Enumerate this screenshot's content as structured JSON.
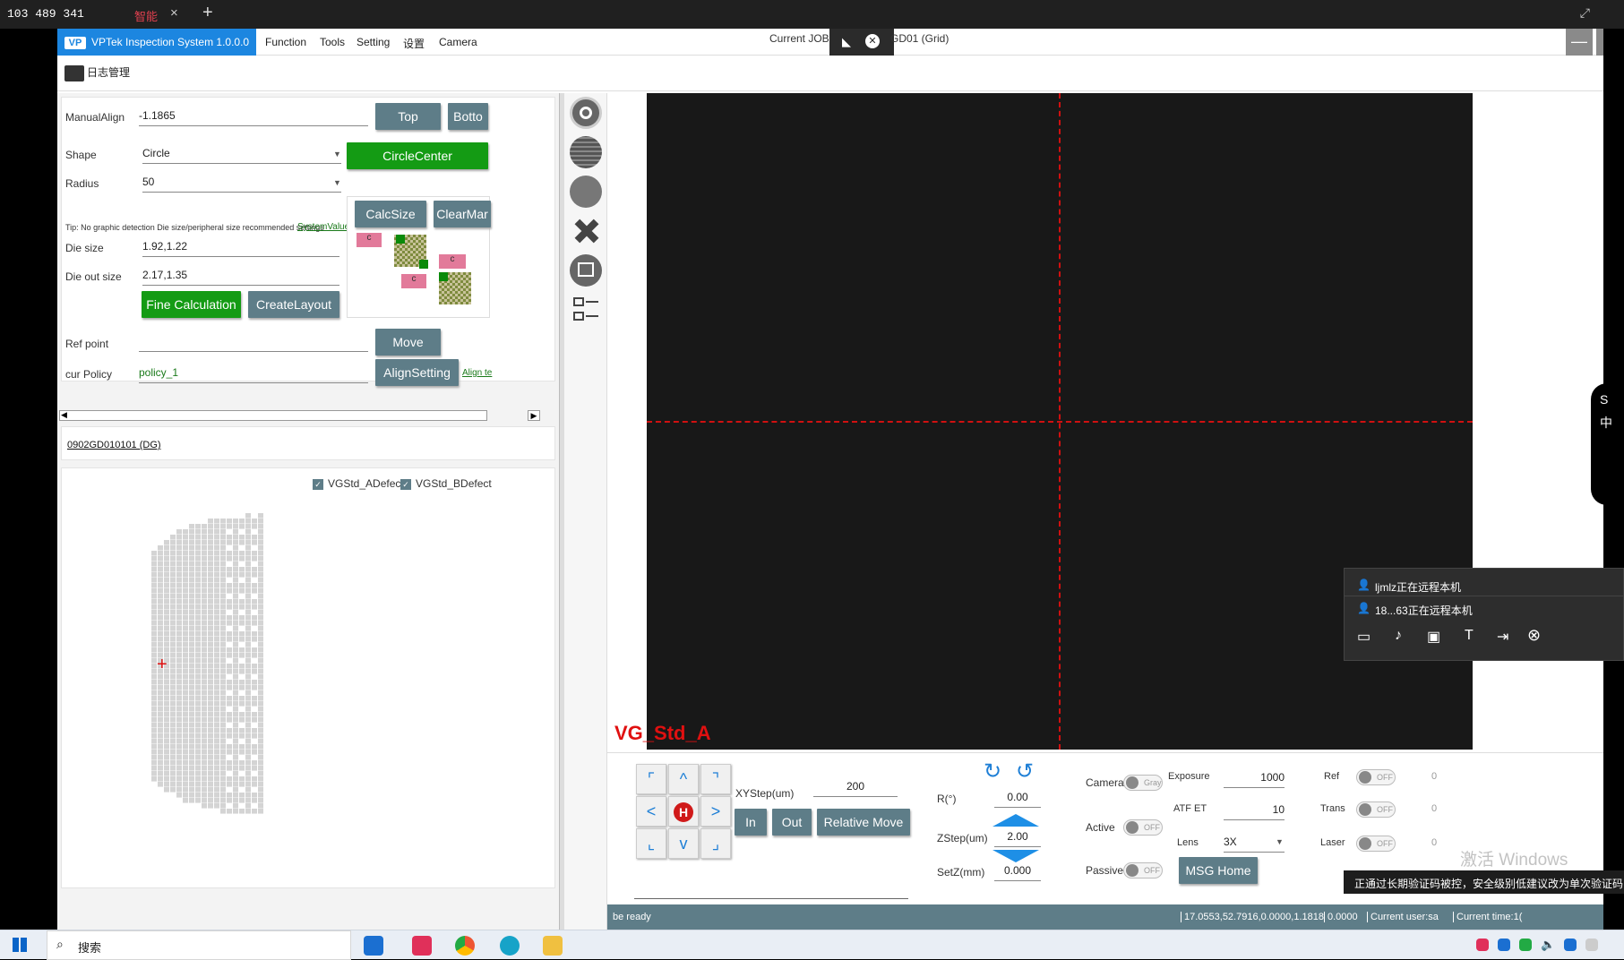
{
  "topbar": {
    "signal_text": "103 489 341",
    "tab_label": "智能",
    "close_glyph": "×",
    "plus_glyph": "+",
    "expand_glyph": "⤢"
  },
  "app": {
    "brand_logo": "VP",
    "brand_title": "VPTek Inspection System 1.0.0.0",
    "menu": [
      "Function",
      "Tools",
      "Setting",
      "设置",
      "Camera"
    ],
    "job_label": "Current JOB",
    "job_suffix": "GD01 (Grid)",
    "log_button": "日志管理"
  },
  "align_panel": {
    "manual_align_label": "ManualAlign",
    "manual_align_value": "-1.1865",
    "top_button": "Top",
    "bottom_button": "Botto",
    "shape_label": "Shape",
    "shape_value": "Circle",
    "circle_center_button": "CircleCenter",
    "radius_label": "Radius",
    "radius_value": "50",
    "tip_text": "Tip: No graphic detection Die size/peripheral size recommended settings",
    "system_value_link": "SystemValue",
    "calc_size_button": "CalcSize",
    "clear_mark_button": "ClearMar",
    "die_size_label": "Die size",
    "die_size_value": "1.92,1.22",
    "die_out_size_label": "Die out size",
    "die_out_size_value": "2.17,1.35",
    "fine_calc_button": "Fine Calculation",
    "create_layout_button": "CreateLayout",
    "ref_point_label": "Ref point",
    "ref_point_value": "",
    "move_button": "Move",
    "cur_policy_label": "cur Policy",
    "cur_policy_value": "policy_1",
    "align_setting_button": "AlignSetting",
    "align_link": "Align te",
    "mark_c": "c"
  },
  "wafer_id": "0902GD010101 (DG)",
  "map": {
    "checkbox_a": "VGStd_ADefect",
    "checkbox_b": "VGStd_BDefect"
  },
  "camera": {
    "view_label": "VG_Std_A"
  },
  "controls": {
    "dpad": [
      "⌜",
      "^",
      "⌝",
      "<",
      "H",
      ">",
      "⌞",
      "v",
      "⌟"
    ],
    "xystep_label": "XYStep(um)",
    "xystep_value": "200",
    "in_button": "In",
    "out_button": "Out",
    "relative_move_button": "Relative Move",
    "r_label": "R(°)",
    "r_value": "0.00",
    "zstep_label": "ZStep(um)",
    "zstep_value": "2.00",
    "setz_label": "SetZ(mm)",
    "setz_value": "0.000",
    "camera_label": "Camera",
    "camera_toggle": "Gray",
    "active_label": "Active",
    "active_toggle": "OFF",
    "passive_label": "Passive",
    "passive_toggle": "OFF",
    "exposure_label": "Exposure",
    "exposure_value": "1000",
    "atf_label": "ATF ET",
    "atf_value": "10",
    "lens_label": "Lens",
    "lens_value": "3X",
    "ref_label": "Ref",
    "ref_toggle": "OFF",
    "ref_value": "0",
    "trans_label": "Trans",
    "trans_toggle": "OFF",
    "trans_value": "0",
    "laser_label": "Laser",
    "laser_toggle": "OFF",
    "laser_value": "0",
    "msg_home_button": "MSG Home"
  },
  "status": {
    "state": "be ready",
    "coords": "17.0553,52.7916,0.0000,1.1818",
    "value": "0.0000",
    "user": "Current user:sa",
    "time": "Current time:1("
  },
  "remote_popup": {
    "line1": "ljmlz正在远程本机",
    "line2": "18...63正在远程本机"
  },
  "notice": "正通过长期验证码被控，安全级别低建议改为单次验证码",
  "watermark": "激活 Windows",
  "taskbar": {
    "search_placeholder": "搜索"
  }
}
